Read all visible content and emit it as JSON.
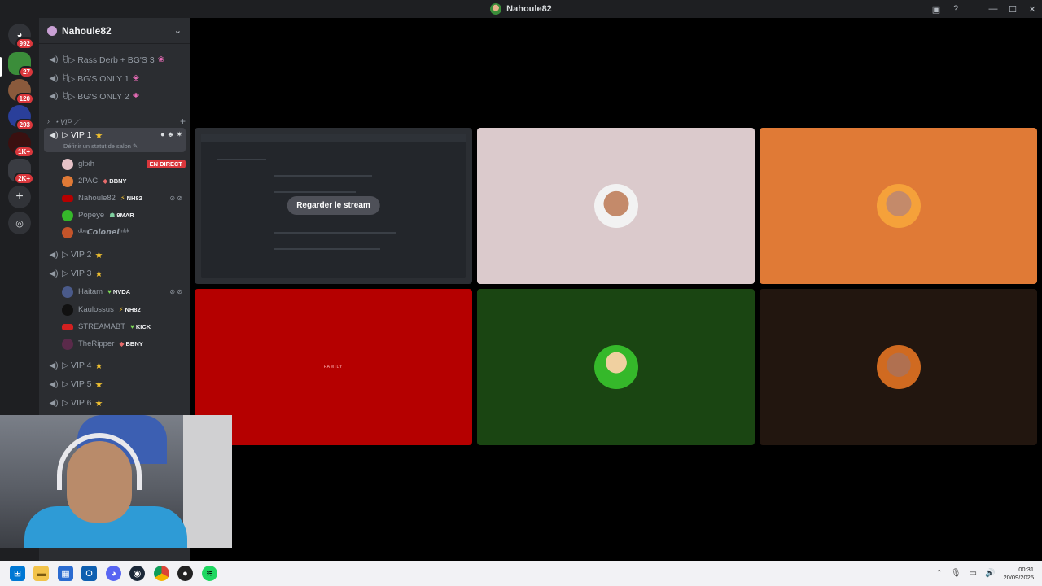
{
  "titlebar": {
    "title": "Nahoule82"
  },
  "rail": {
    "servers": [
      {
        "name": "discord-home",
        "badge": "992"
      },
      {
        "name": "server-1",
        "badge": "27"
      },
      {
        "name": "server-2",
        "badge": "120"
      },
      {
        "name": "server-3",
        "badge": "293"
      },
      {
        "name": "server-4",
        "badge": "1K+"
      },
      {
        "name": "server-folder",
        "badge": "2K+"
      }
    ]
  },
  "sidebar": {
    "guild_name": "Nahoule82",
    "channels_top": [
      {
        "label": "ꀀ▷ Rass Derb + BG'S 3"
      },
      {
        "label": "ꀀ▷ BG'S ONLY 1"
      },
      {
        "label": "ꀀ▷ BG'S ONLY 2"
      }
    ],
    "category": "・VIP ⟋",
    "vip1": {
      "label": "▷ VIP 1",
      "status_hint": "Définir un statut de salon"
    },
    "vip1_users": [
      {
        "name": "gltxh",
        "tag": "",
        "live": "EN DIRECT"
      },
      {
        "name": "2PAC",
        "tag": "BBNY"
      },
      {
        "name": "Nahoule82",
        "tag": "NH82"
      },
      {
        "name": "Popeye",
        "tag": "9MAR"
      },
      {
        "name": "ᵈᵇᵘ𝘾𝙤𝙡𝙤𝙣𝙚𝙡ᵐᵇᵏ",
        "tag": ""
      }
    ],
    "vip2": {
      "label": "▷ VIP 2"
    },
    "vip3": {
      "label": "▷ VIP 3"
    },
    "vip3_users": [
      {
        "name": "Haitam",
        "tag": "NVDA"
      },
      {
        "name": "Kaulossus",
        "tag": "NH82"
      },
      {
        "name": "STREAMABT",
        "tag": "KICK"
      },
      {
        "name": "TheRipper",
        "tag": "BBNY"
      }
    ],
    "vip4": {
      "label": "▷ VIP 4"
    },
    "vip5": {
      "label": "▷ VIP 5"
    },
    "vip6": {
      "label": "▷ VIP 6"
    }
  },
  "stage": {
    "watch_stream": "Regarder le stream",
    "red_tile_text": "FAMILY"
  },
  "taskbar": {
    "time": "00:31",
    "date": "20/09/2025"
  },
  "colors": {
    "tile_pink": "#dbcacc",
    "tile_orange": "#e07a36",
    "tile_red": "#b50000",
    "tile_green": "#1a4512",
    "tile_dark": "#22160f"
  }
}
